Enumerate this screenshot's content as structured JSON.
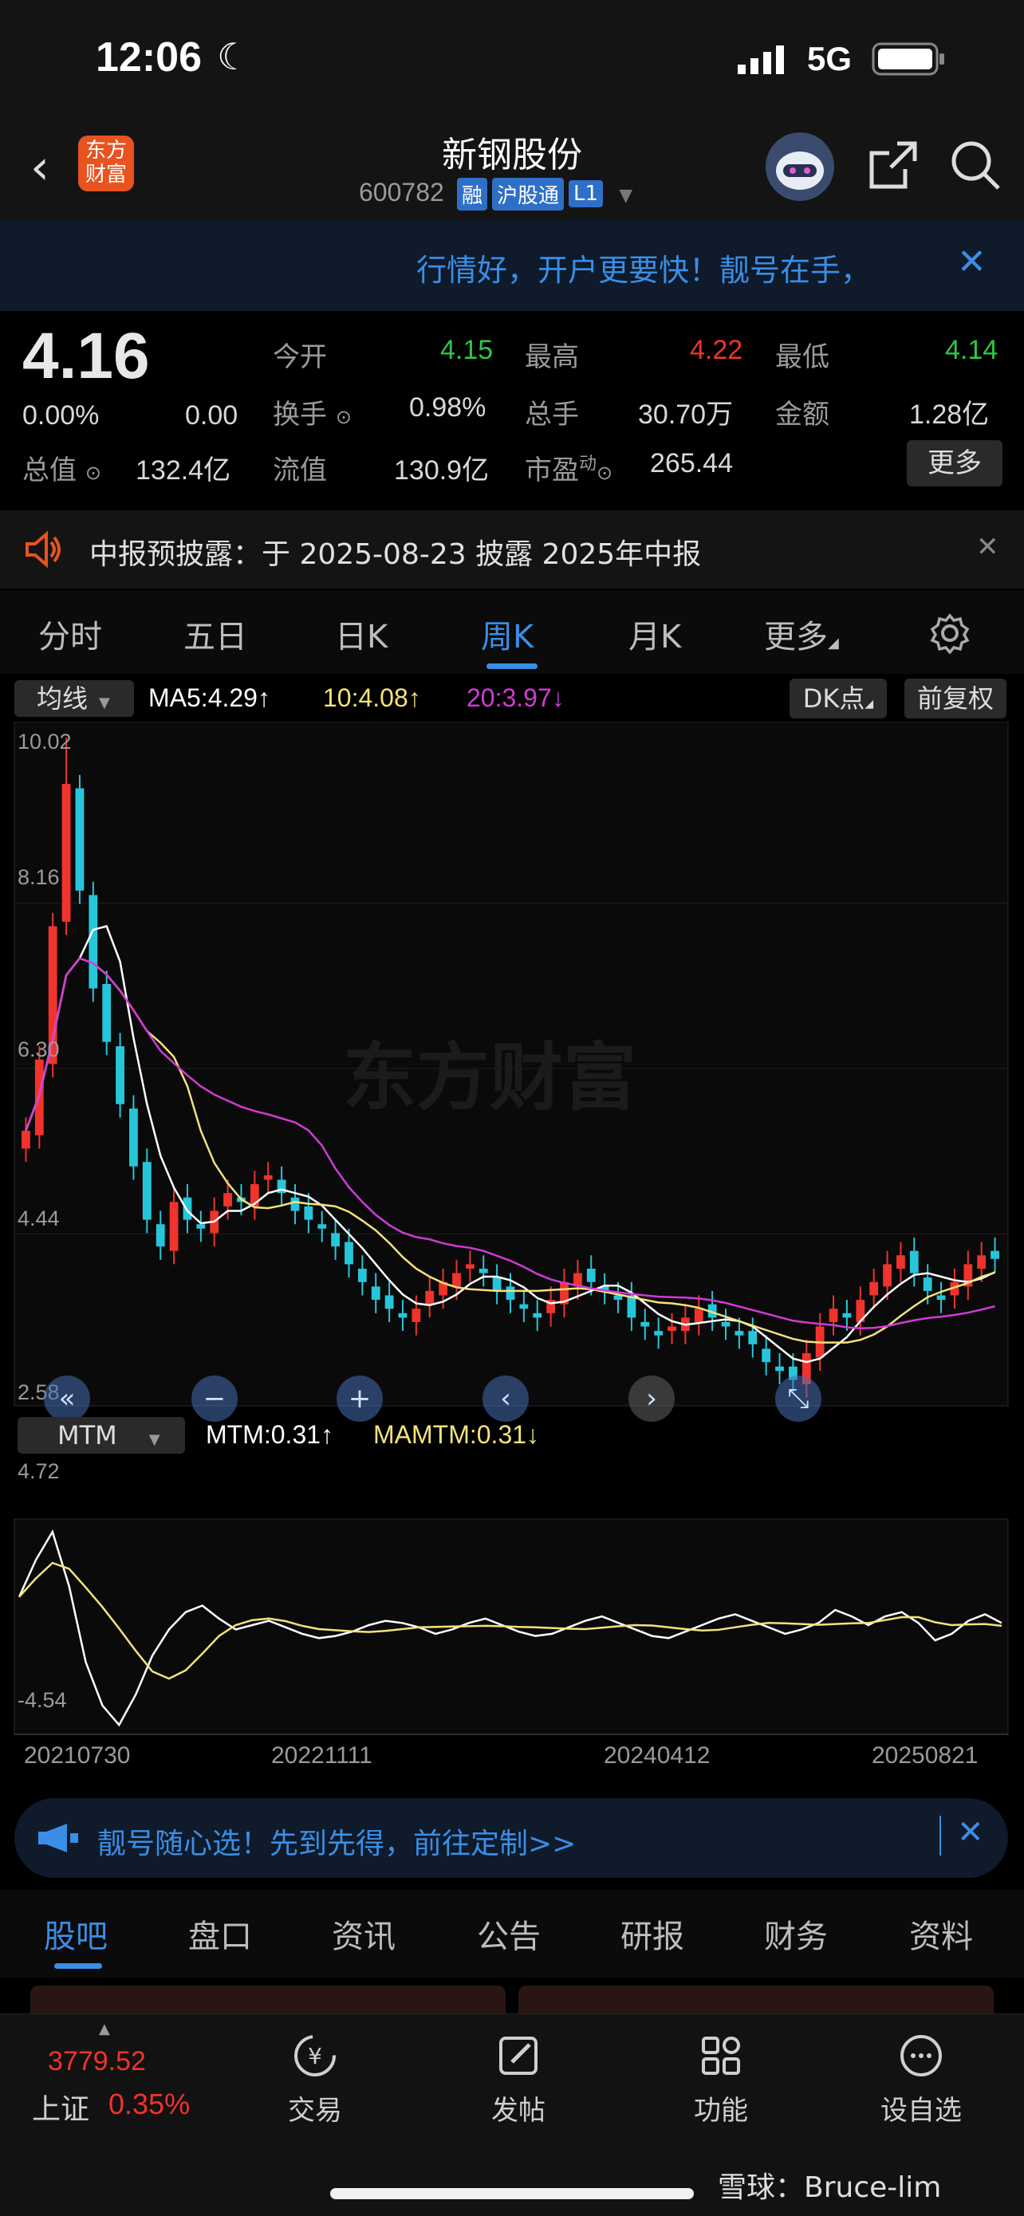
{
  "status": {
    "time": "12:06",
    "network": "5G"
  },
  "header": {
    "logo_text": "东方财富",
    "stock_name": "新钢股份",
    "stock_code": "600782",
    "tags": [
      "融",
      "沪股通",
      "L1"
    ]
  },
  "banner": {
    "text": "行情好，开户更要快！靓号在手，"
  },
  "quote": {
    "price": "4.16",
    "change_pct": "0.00%",
    "change": "0.00",
    "open_label": "今开",
    "open": "4.15",
    "high_label": "最高",
    "high": "4.22",
    "low_label": "最低",
    "low": "4.14",
    "turnover_label": "换手",
    "turnover": "0.98%",
    "volume_label": "总手",
    "volume": "30.70万",
    "amount_label": "金额",
    "amount": "1.28亿",
    "mktcap_label": "总值",
    "mktcap": "132.4亿",
    "float_label": "流值",
    "float_cap": "130.9亿",
    "pe_label": "市盈",
    "pe_sup": "动",
    "pe": "265.44",
    "more_label": "更多"
  },
  "notice": {
    "text": "中报预披露：于 2025-08-23 披露 2025年中报"
  },
  "kline_tabs": [
    "分时",
    "五日",
    "日K",
    "周K",
    "月K",
    "更多"
  ],
  "active_kline_tab": "周K",
  "indicator": {
    "ma_selector": "均线",
    "ma5": "MA5:4.29",
    "ma10": "10:4.08",
    "ma20": "20:3.97",
    "dk_button": "DK点",
    "fq_button": "前复权",
    "watermark": "东方财富",
    "mtm_selector": "MTM",
    "mtm_value": "MTM:0.31",
    "mamtm_value": "MAMTM:0.31",
    "colors": {
      "ma5": "#ffffff",
      "ma10": "#f4e27a",
      "ma20": "#d13ad6",
      "up": "#f0332d",
      "down": "#26c6da"
    }
  },
  "chart_data": {
    "type": "candlestick",
    "price_axis_labels": [
      "10.02",
      "8.16",
      "6.30",
      "4.44",
      "2.58"
    ],
    "mtm_axis_labels": [
      "4.72",
      "-4.54"
    ],
    "date_labels": [
      "20210730",
      "20221111",
      "20240412",
      "20250821"
    ],
    "close_series": [
      5.6,
      6.4,
      7.9,
      9.5,
      8.3,
      7.2,
      6.6,
      5.9,
      5.2,
      4.6,
      4.3,
      4.8,
      4.6,
      4.5,
      4.7,
      4.9,
      4.8,
      5.0,
      5.1,
      4.9,
      4.7,
      4.6,
      4.5,
      4.3,
      4.1,
      3.9,
      3.7,
      3.6,
      3.5,
      3.6,
      3.8,
      3.9,
      4.0,
      4.1,
      4.0,
      3.8,
      3.7,
      3.6,
      3.5,
      3.7,
      3.9,
      4.0,
      3.9,
      3.8,
      3.7,
      3.5,
      3.4,
      3.3,
      3.4,
      3.5,
      3.6,
      3.5,
      3.4,
      3.3,
      3.2,
      3.0,
      2.9,
      2.8,
      3.1,
      3.4,
      3.6,
      3.5,
      3.7,
      3.9,
      4.1,
      4.2,
      4.0,
      3.8,
      3.7,
      3.9,
      4.1,
      4.2,
      4.16
    ],
    "mtm_series": [
      1.5,
      3.2,
      4.5,
      2.0,
      -1.5,
      -3.5,
      -4.4,
      -3.0,
      -1.2,
      0.0,
      0.8,
      1.1,
      0.5,
      0.0,
      0.2,
      0.4,
      0.1,
      -0.2,
      -0.4,
      -0.3,
      -0.1,
      0.2,
      0.4,
      0.3,
      0.1,
      -0.2,
      0.0,
      0.3,
      0.5,
      0.2,
      -0.1,
      -0.3,
      -0.2,
      0.1,
      0.4,
      0.6,
      0.3,
      0.0,
      -0.3,
      -0.4,
      -0.1,
      0.2,
      0.5,
      0.7,
      0.4,
      0.1,
      -0.2,
      0.0,
      0.3,
      0.9,
      0.6,
      0.2,
      0.6,
      0.8,
      0.3,
      -0.5,
      -0.2,
      0.4,
      0.7,
      0.3
    ]
  },
  "ad2": {
    "text": "靓号随心选！先到先得，前往定制>>"
  },
  "bottom_tabs": [
    "股吧",
    "盘口",
    "资讯",
    "公告",
    "研报",
    "财务",
    "资料"
  ],
  "active_bottom_tab": "股吧",
  "bottombar": {
    "index_value": "3779.52",
    "index_name": "上证",
    "index_change": "0.35%",
    "items": [
      "交易",
      "发帖",
      "功能",
      "设自选"
    ],
    "watermark": "雪球：Bruce-lim"
  }
}
